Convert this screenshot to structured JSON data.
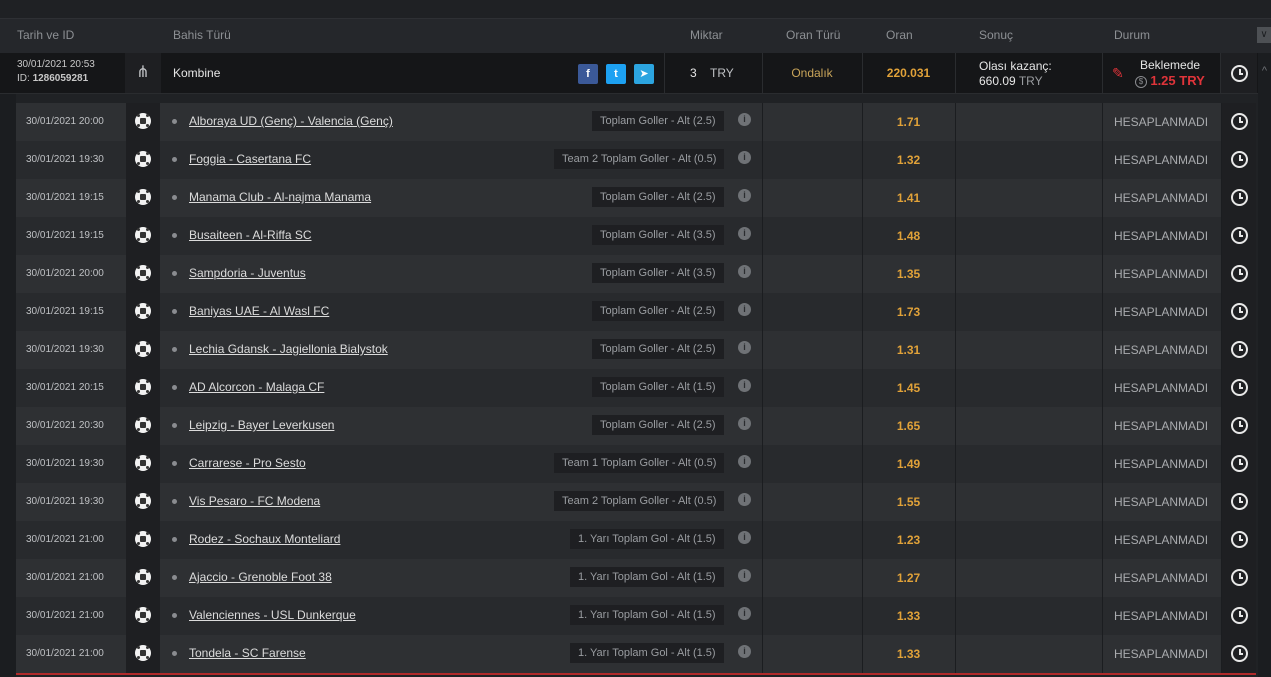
{
  "columns": {
    "date_id": "Tarih ve ID",
    "bet_type": "Bahis Türü",
    "amount": "Miktar",
    "odds_type": "Oran Türü",
    "odds": "Oran",
    "result": "Sonuç",
    "status": "Durum",
    "collapse_icon": "double-chevron-down-icon"
  },
  "bet": {
    "date": "30/01/2021 20:53",
    "id_label": "ID:",
    "id": "1286059281",
    "type": "Kombine",
    "amount": "3",
    "currency": "TRY",
    "odds_type": "Ondalık",
    "odds": "220.031",
    "possible_win_label": "Olası kazanç:",
    "possible_win_value": "660.09",
    "possible_win_currency": "TRY",
    "status": "Beklemede",
    "cashout": "1.25 TRY",
    "colors": {
      "odds": "#e1a239",
      "cashout": "#e0343a",
      "facebook": "#3b5998",
      "twitter": "#1da1f2",
      "telegram": "#2ca5e0"
    }
  },
  "selections": [
    {
      "date": "30/01/2021 20:00",
      "match": "Alboraya UD (Genç) - Valencia (Genç)",
      "market": "Toplam Goller - Alt (2.5)",
      "odds": "1.71",
      "status": "HESAPLANMADI"
    },
    {
      "date": "30/01/2021 19:30",
      "match": "Foggia - Casertana FC",
      "market": "Team 2 Toplam Goller - Alt (0.5)",
      "odds": "1.32",
      "status": "HESAPLANMADI"
    },
    {
      "date": "30/01/2021 19:15",
      "match": "Manama Club - Al-najma Manama",
      "market": "Toplam Goller - Alt (2.5)",
      "odds": "1.41",
      "status": "HESAPLANMADI"
    },
    {
      "date": "30/01/2021 19:15",
      "match": "Busaiteen - Al-Riffa SC",
      "market": "Toplam Goller - Alt (3.5)",
      "odds": "1.48",
      "status": "HESAPLANMADI"
    },
    {
      "date": "30/01/2021 20:00",
      "match": "Sampdoria - Juventus",
      "market": "Toplam Goller - Alt (3.5)",
      "odds": "1.35",
      "status": "HESAPLANMADI"
    },
    {
      "date": "30/01/2021 19:15",
      "match": "Baniyas UAE - Al Wasl FC",
      "market": "Toplam Goller - Alt (2.5)",
      "odds": "1.73",
      "status": "HESAPLANMADI"
    },
    {
      "date": "30/01/2021 19:30",
      "match": "Lechia Gdansk - Jagiellonia Bialystok",
      "market": "Toplam Goller - Alt (2.5)",
      "odds": "1.31",
      "status": "HESAPLANMADI"
    },
    {
      "date": "30/01/2021 20:15",
      "match": "AD Alcorcon - Malaga CF",
      "market": "Toplam Goller - Alt (1.5)",
      "odds": "1.45",
      "status": "HESAPLANMADI"
    },
    {
      "date": "30/01/2021 20:30",
      "match": "Leipzig - Bayer Leverkusen",
      "market": "Toplam Goller - Alt (2.5)",
      "odds": "1.65",
      "status": "HESAPLANMADI"
    },
    {
      "date": "30/01/2021 19:30",
      "match": "Carrarese - Pro Sesto",
      "market": "Team 1 Toplam Goller - Alt (0.5)",
      "odds": "1.49",
      "status": "HESAPLANMADI"
    },
    {
      "date": "30/01/2021 19:30",
      "match": "Vis Pesaro - FC Modena",
      "market": "Team 2 Toplam Goller - Alt (0.5)",
      "odds": "1.55",
      "status": "HESAPLANMADI"
    },
    {
      "date": "30/01/2021 21:00",
      "match": "Rodez - Sochaux Monteliard",
      "market": "1. Yarı Toplam Gol - Alt (1.5)",
      "odds": "1.23",
      "status": "HESAPLANMADI"
    },
    {
      "date": "30/01/2021 21:00",
      "match": "Ajaccio - Grenoble Foot 38",
      "market": "1. Yarı Toplam Gol - Alt (1.5)",
      "odds": "1.27",
      "status": "HESAPLANMADI"
    },
    {
      "date": "30/01/2021 21:00",
      "match": "Valenciennes - USL Dunkerque",
      "market": "1. Yarı Toplam Gol - Alt (1.5)",
      "odds": "1.33",
      "status": "HESAPLANMADI"
    },
    {
      "date": "30/01/2021 21:00",
      "match": "Tondela - SC Farense",
      "market": "1. Yarı Toplam Gol - Alt (1.5)",
      "odds": "1.33",
      "status": "HESAPLANMADI"
    }
  ]
}
